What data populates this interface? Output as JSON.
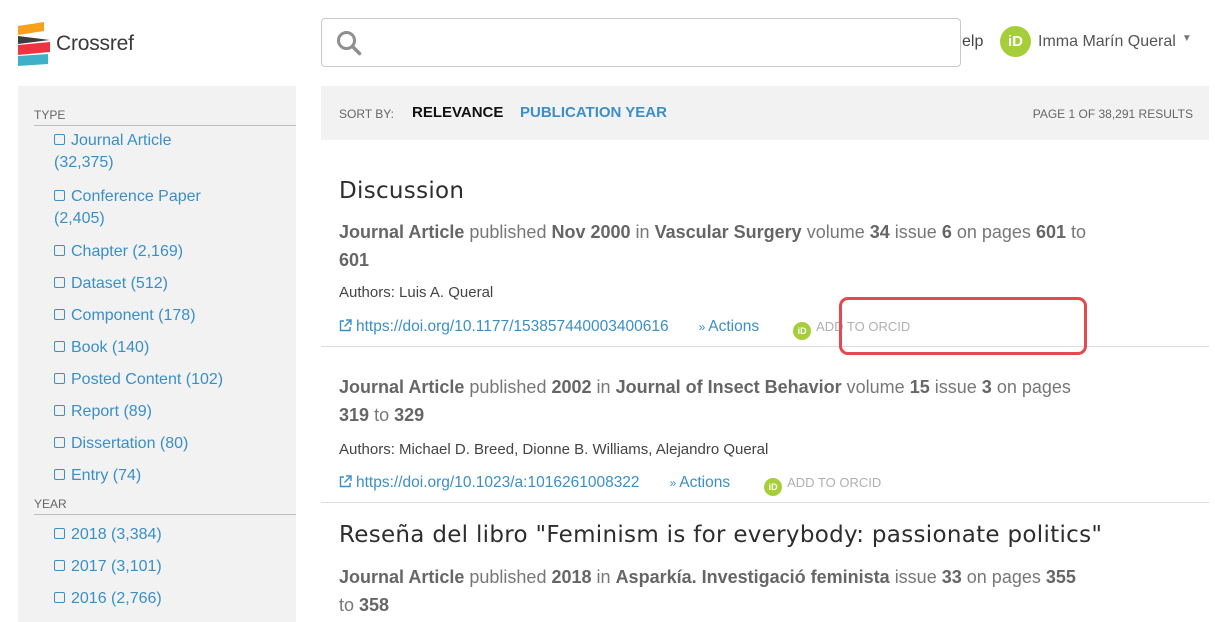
{
  "header": {
    "logo_text": "Crossref",
    "search": {
      "value": "",
      "placeholder": ""
    },
    "help_label": "elp",
    "user": {
      "badge": "iD",
      "name": "Imma Marín Queral"
    }
  },
  "sidebar": {
    "type_title": "TYPE",
    "type_items": [
      {
        "label": "Journal Article",
        "count": "(32,375)"
      },
      {
        "label": "Conference Paper",
        "count": "(2,405)"
      },
      {
        "label": "Chapter (2,169)"
      },
      {
        "label": "Dataset (512)"
      },
      {
        "label": "Component (178)"
      },
      {
        "label": "Book (140)"
      },
      {
        "label": "Posted Content (102)"
      },
      {
        "label": "Report (89)"
      },
      {
        "label": "Dissertation (80)"
      },
      {
        "label": "Entry (74)"
      }
    ],
    "year_title": "YEAR",
    "year_items": [
      {
        "label": "2018 (3,384)"
      },
      {
        "label": "2017 (3,101)"
      },
      {
        "label": "2016 (2,766)"
      }
    ]
  },
  "sortbar": {
    "label": "SORT BY:",
    "relevance": "RELEVANCE",
    "year": "PUBLICATION YEAR",
    "page_info": "PAGE 1 OF 38,291 RESULTS"
  },
  "results": [
    {
      "title": "Discussion",
      "type": "Journal Article",
      "published_word": "published",
      "date": "Nov 2000",
      "in_word": "in",
      "journal": "Vascular Surgery",
      "volume_word": "volume",
      "volume": "34",
      "issue_word": "issue",
      "issue": "6",
      "pages_word": "on pages",
      "page_start": "601",
      "to_word": "to",
      "page_end": "601",
      "authors": "Authors: Luis A. Queral",
      "doi": "https://doi.org/10.1177/153857440003400616",
      "actions": "Actions",
      "add_orcid": "ADD TO ORCID"
    },
    {
      "title": "",
      "type": "Journal Article",
      "published_word": "published",
      "date": "2002",
      "in_word": "in",
      "journal": "Journal of Insect Behavior",
      "volume_word": "volume",
      "volume": "15",
      "issue_word": "issue",
      "issue": "3",
      "pages_word": "on pages",
      "page_start": "319",
      "to_word": "to",
      "page_end": "329",
      "authors": "Authors: Michael D. Breed, Dionne B. Williams, Alejandro Queral",
      "doi": "https://doi.org/10.1023/a:1016261008322",
      "actions": "Actions",
      "add_orcid": "ADD TO ORCID"
    },
    {
      "title": "Reseña del libro \"Feminism is for everybody: passionate politics\"",
      "type": "Journal Article",
      "published_word": "published",
      "date": "2018",
      "in_word": "in",
      "journal": "Asparkía. Investigació feminista",
      "issue_word": "issue",
      "issue": "33",
      "pages_word": "on pages",
      "page_start": "355",
      "to_word": "to",
      "page_end": "358"
    }
  ],
  "colors": {
    "link": "#3a8fc7",
    "orcid_green": "#a6ce39",
    "highlight_red": "#e5484d",
    "panel_gray": "#f2f2f2"
  },
  "icons": [
    "crossref-logo",
    "search-icon",
    "orcid-icon",
    "chevron-down-icon",
    "checkbox-icon",
    "external-link-icon",
    "double-chevron-down-icon"
  ]
}
